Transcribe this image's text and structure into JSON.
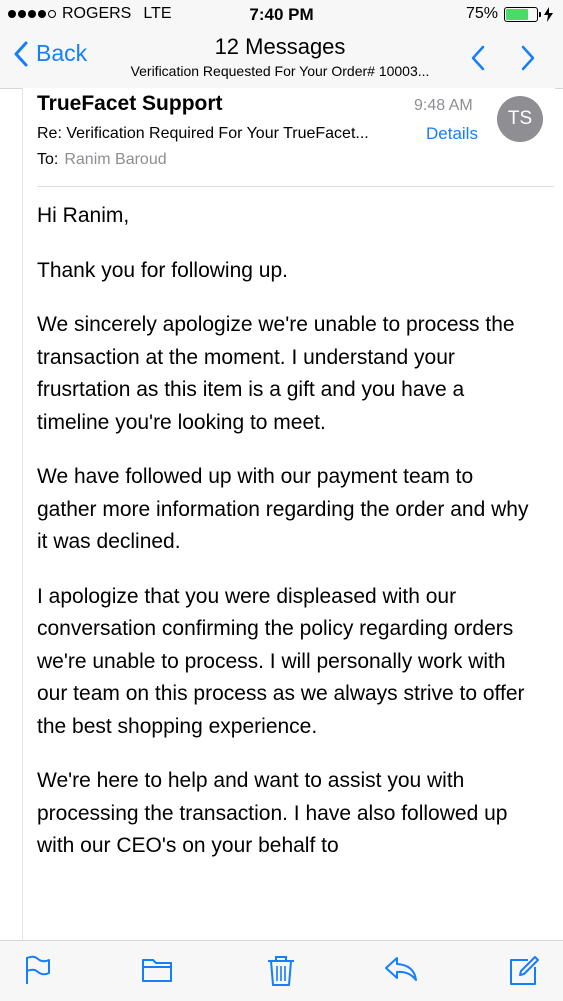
{
  "status_bar": {
    "carrier": "ROGERS",
    "network": "LTE",
    "time": "7:40 PM",
    "battery": "75%",
    "battery_level": 0.75
  },
  "nav": {
    "back_label": "Back",
    "title": "12 Messages",
    "subtitle": "Verification Requested For Your Order# 10003..."
  },
  "message": {
    "sender": "TrueFacet Support",
    "time": "9:48 AM",
    "avatar_initials": "TS",
    "subject": "Re: Verification Required For Your TrueFacet...",
    "details_label": "Details",
    "to_label": "To:",
    "recipient": "Ranim Baroud",
    "body": [
      "Hi Ranim,",
      "Thank you for following up.",
      "We sincerely apologize we're unable to process the transaction at the moment. I understand your frusrtation as this item is a gift and you have a timeline you're looking to meet.",
      "We have followed up with our payment team to gather more information regarding the order and why it was declined.",
      "I apologize that you were displeased with our conversation confirming the policy regarding orders we're unable to process. I will personally work with our team on this process as we always strive to offer the best shopping experience.",
      "We're here to help and want to assist you with processing the transaction. I have also followed up with our CEO's on your behalf to"
    ]
  },
  "toolbar": {
    "icons": [
      "flag-icon",
      "folder-icon",
      "trash-icon",
      "reply-icon",
      "compose-icon"
    ]
  },
  "colors": {
    "accent": "#157efb",
    "muted": "#8e8e93",
    "battery": "#4cd964"
  }
}
